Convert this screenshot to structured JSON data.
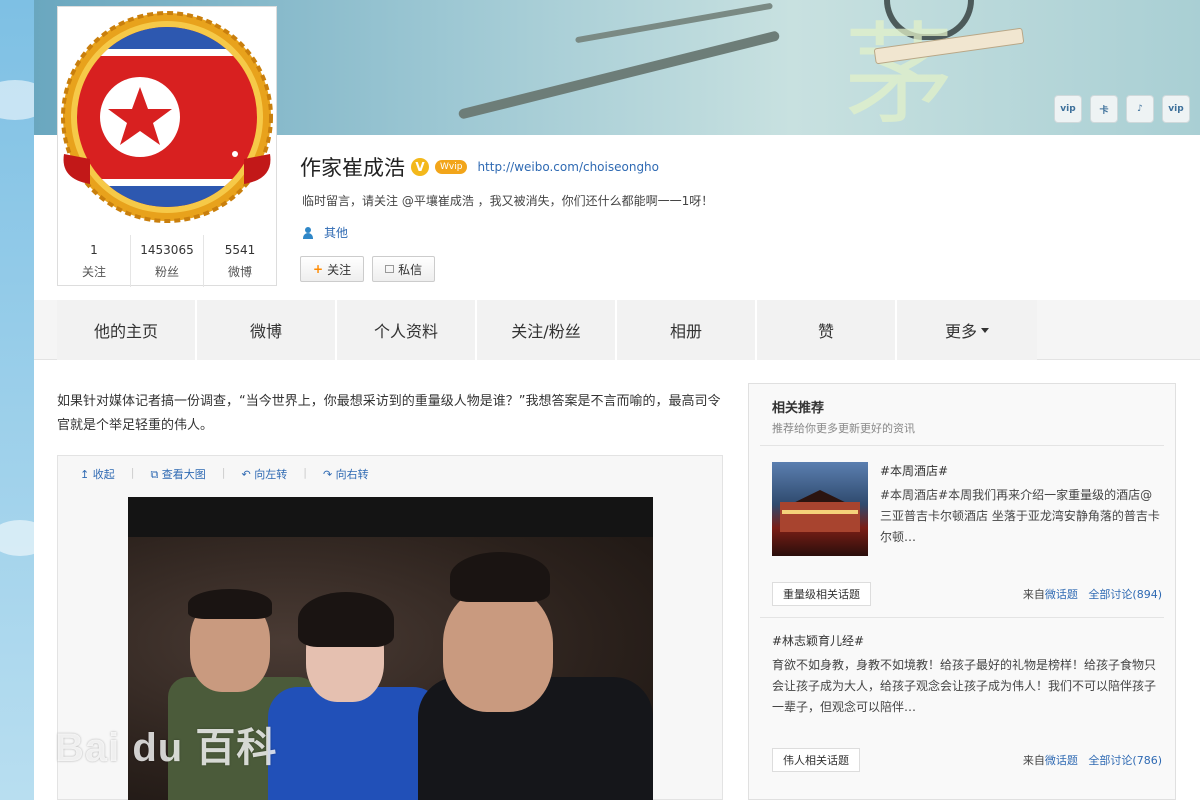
{
  "profile": {
    "name": "作家崔成浩",
    "badge_char": "V",
    "vip_label": "Wvip",
    "url": "http://weibo.com/choiseongho",
    "bio": "临时留言，请关注 @平壤崔成浩 ，我又被消失，你们还什么都能啊一一1呀！",
    "tag": "其他",
    "stats": [
      {
        "num": "1",
        "label": "关注"
      },
      {
        "num": "1453065",
        "label": "粉丝"
      },
      {
        "num": "5541",
        "label": "微博"
      }
    ],
    "follow_label": "关注",
    "message_label": "私信"
  },
  "banner": {
    "vip_badges": [
      "vip",
      "卡",
      "♪",
      "vip"
    ]
  },
  "nav": {
    "items": [
      "他的主页",
      "微博",
      "个人资料",
      "关注/粉丝",
      "相册",
      "赞",
      "更多"
    ]
  },
  "post": {
    "text": "如果针对媒体记者搞一份调查，“当今世界上，你最想采访到的重量级人物是谁？”我想答案是不言而喻的，最高司令官就是个举足轻重的伟人。",
    "toolbar": [
      "收起",
      "查看大图",
      "向左转",
      "向右转"
    ]
  },
  "watermark": "Bai du 百科",
  "sidebar": {
    "title": "相关推荐",
    "subtitle": "推荐给你更多更新更好的资讯",
    "topics": [
      {
        "name": "#本周酒店#",
        "desc": "#本周酒店#本周我们再来介绍一家重量级的酒店@三亚普吉卡尔顿酒店 坐落于亚龙湾安静角落的普吉卡尔顿…",
        "tag": "重量级相关话题",
        "from_prefix": "来自",
        "from_link": "微话题",
        "discuss": "全部讨论(894)"
      },
      {
        "name": "#林志颖育儿经#",
        "desc": "育欲不如身教，身教不如境教！给孩子最好的礼物是榜样！给孩子食物只会让孩子成为大人，给孩子观念会让孩子成为伟人！我们不可以陪伴孩子一辈子，但观念可以陪伴…",
        "tag": "伟人相关话题",
        "from_prefix": "来自",
        "from_link": "微话题",
        "discuss": "全部讨论(786)"
      }
    ]
  }
}
